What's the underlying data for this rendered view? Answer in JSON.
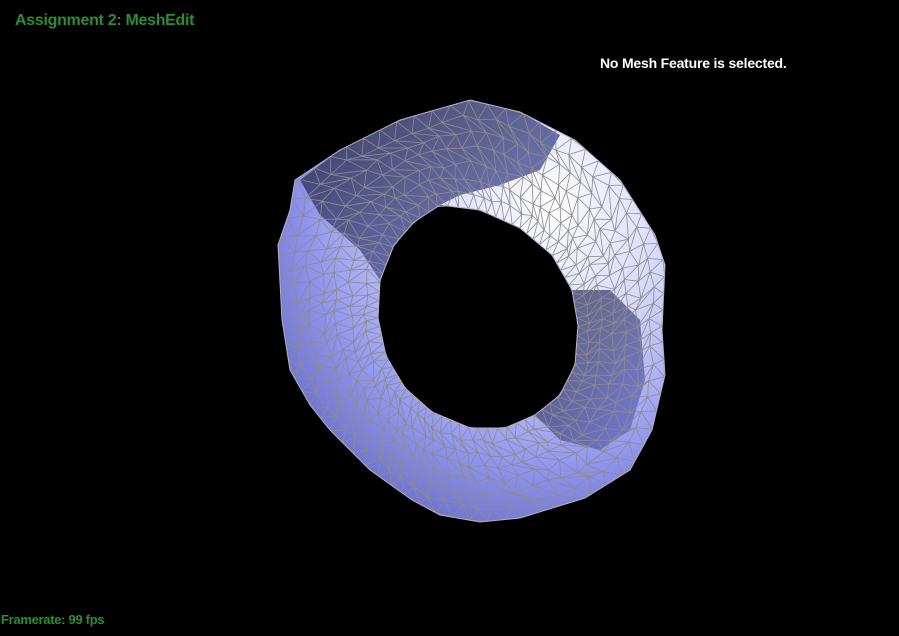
{
  "hud": {
    "title": "Assignment 2: MeshEdit",
    "status": "No Mesh Feature is selected.",
    "framerate": "Framerate: 99 fps"
  },
  "colors": {
    "background": "#000000",
    "hud_green": "#2e8b36",
    "hud_white": "#ffffff",
    "mesh_light": "#ffffff",
    "mesh_mid": "#9fa2f5",
    "mesh_dark": "#2a2b45",
    "wire": "#8c8c8c"
  }
}
